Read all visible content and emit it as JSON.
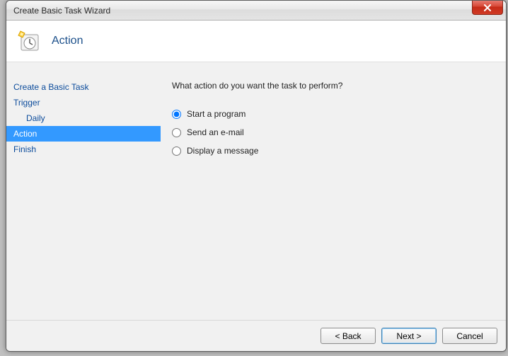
{
  "window": {
    "title": "Create Basic Task Wizard"
  },
  "header": {
    "title": "Action"
  },
  "sidebar": {
    "steps": [
      {
        "label": "Create a Basic Task",
        "indent": false,
        "selected": false
      },
      {
        "label": "Trigger",
        "indent": false,
        "selected": false
      },
      {
        "label": "Daily",
        "indent": true,
        "selected": false
      },
      {
        "label": "Action",
        "indent": false,
        "selected": true
      },
      {
        "label": "Finish",
        "indent": false,
        "selected": false
      }
    ]
  },
  "content": {
    "prompt": "What action do you want the task to perform?",
    "options": [
      {
        "label": "Start a program",
        "checked": true
      },
      {
        "label": "Send an e-mail",
        "checked": false
      },
      {
        "label": "Display a message",
        "checked": false
      }
    ]
  },
  "buttons": {
    "back": "< Back",
    "next": "Next >",
    "cancel": "Cancel"
  }
}
